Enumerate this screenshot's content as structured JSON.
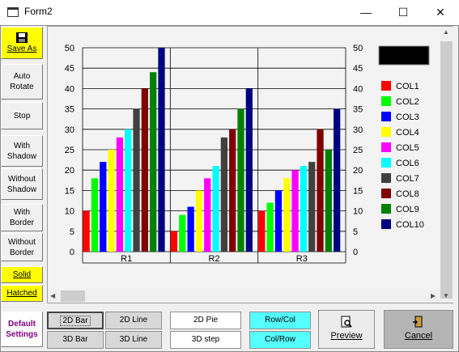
{
  "window": {
    "title": "Form2",
    "minimize": "—",
    "maximize": "☐",
    "close": "✕"
  },
  "left_buttons": {
    "save_as": "Save As",
    "auto_rotate": [
      "Auto",
      "Rotate"
    ],
    "stop": "Stop",
    "with_shadow": [
      "With",
      "Shadow"
    ],
    "without_shadow": [
      "Without",
      "Shadow"
    ],
    "with_border": [
      "With",
      "Border"
    ],
    "without_border": [
      "Without",
      "Border"
    ],
    "solid": "Solid",
    "hatched": "Hatched",
    "default_settings": [
      "Default",
      "Settings"
    ]
  },
  "bottom_buttons": {
    "bar2d": "2D Bar",
    "bar3d": "3D Bar",
    "line2d": "2D Line",
    "line3d": "3D Line",
    "pie2d": "2D Pie",
    "step3d": "3D step",
    "rowcol": "Row/Col",
    "colrow": "Col/Row",
    "preview": "Preview",
    "cancel": "Cancel"
  },
  "colors": {
    "yellow_button": "#ffff00",
    "cyan_button": "#55ffff",
    "default_settings_text": "#800080"
  },
  "chart_data": {
    "type": "bar",
    "categories": [
      "R1",
      "R2",
      "R3"
    ],
    "ylim": [
      0,
      50
    ],
    "yticks": [
      0,
      5,
      10,
      15,
      20,
      25,
      30,
      35,
      40,
      45,
      50
    ],
    "grid": true,
    "legend_placement": "right",
    "series": [
      {
        "name": "COL1",
        "color": "#ff0000",
        "values": [
          10,
          5,
          10
        ]
      },
      {
        "name": "COL2",
        "color": "#00ff00",
        "values": [
          18,
          9,
          12
        ]
      },
      {
        "name": "COL3",
        "color": "#0000ff",
        "values": [
          22,
          11,
          15
        ]
      },
      {
        "name": "COL4",
        "color": "#ffff00",
        "values": [
          25,
          15,
          18
        ]
      },
      {
        "name": "COL5",
        "color": "#ff00ff",
        "values": [
          28,
          18,
          20
        ]
      },
      {
        "name": "COL6",
        "color": "#00ffff",
        "values": [
          30,
          21,
          21
        ]
      },
      {
        "name": "COL7",
        "color": "#404040",
        "values": [
          35,
          28,
          22
        ]
      },
      {
        "name": "COL8",
        "color": "#800000",
        "values": [
          40,
          30,
          30
        ]
      },
      {
        "name": "COL9",
        "color": "#008000",
        "values": [
          44,
          35,
          25
        ]
      },
      {
        "name": "COL10",
        "color": "#000080",
        "values": [
          50,
          40,
          35
        ]
      }
    ]
  }
}
